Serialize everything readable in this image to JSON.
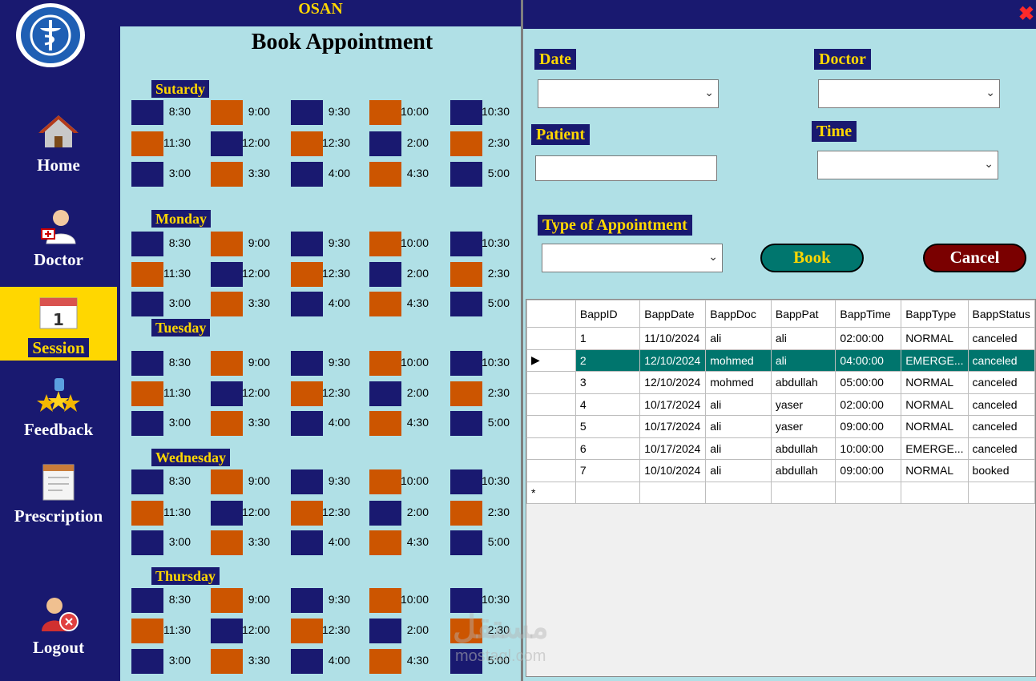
{
  "app": {
    "title": "OSAN",
    "page_title": "Book Appointment"
  },
  "sidebar": {
    "items": [
      {
        "label": "Home",
        "icon": "home-icon"
      },
      {
        "label": "Doctor",
        "icon": "doctor-icon"
      },
      {
        "label": "Session",
        "icon": "calendar-icon",
        "active": true
      },
      {
        "label": "Feedback",
        "icon": "feedback-stars-icon"
      },
      {
        "label": "Prescription",
        "icon": "prescription-icon"
      },
      {
        "label": "Logout",
        "icon": "logout-user-icon"
      }
    ]
  },
  "schedule": {
    "days": [
      "Sutardy",
      "Monday",
      "Tuesday",
      "Wednesday",
      "Thursday"
    ],
    "times": [
      [
        "8:30",
        "9:00",
        "9:30",
        "10:00",
        "10:30"
      ],
      [
        "11:30",
        "12:00",
        "12:30",
        "2:00",
        "2:30"
      ],
      [
        "3:00",
        "3:30",
        "4:00",
        "4:30",
        "5:00"
      ]
    ],
    "colors": {
      "blue": "#191970",
      "orange": "#cc5500"
    }
  },
  "form": {
    "date_label": "Date",
    "doctor_label": "Doctor",
    "patient_label": "Patient",
    "time_label": "Time",
    "type_label": "Type of Appointment",
    "book_label": "Book",
    "cancel_label": "Cancel",
    "close": "✖"
  },
  "grid": {
    "columns": [
      "BappID",
      "BappDate",
      "BappDoc",
      "BappPat",
      "BappTime",
      "BappType",
      "BappStatus"
    ],
    "rows": [
      [
        "1",
        "11/10/2024",
        "ali",
        "ali",
        "02:00:00",
        "NORMAL",
        "canceled"
      ],
      [
        "2",
        "12/10/2024",
        "mohmed",
        "ali",
        "04:00:00",
        "EMERGE...",
        "canceled"
      ],
      [
        "3",
        "12/10/2024",
        "mohmed",
        "abdullah",
        "05:00:00",
        "NORMAL",
        "canceled"
      ],
      [
        "4",
        "10/17/2024",
        "ali",
        "yaser",
        "02:00:00",
        "NORMAL",
        "canceled"
      ],
      [
        "5",
        "10/17/2024",
        "ali",
        "yaser",
        "09:00:00",
        "NORMAL",
        "canceled"
      ],
      [
        "6",
        "10/17/2024",
        "ali",
        "abdullah",
        "10:00:00",
        "EMERGE...",
        "canceled"
      ],
      [
        "7",
        "10/10/2024",
        "ali",
        "abdullah",
        "09:00:00",
        "NORMAL",
        "booked"
      ]
    ],
    "selected_row": 1,
    "current_marker": "▶",
    "new_row_marker": "*"
  },
  "watermark": {
    "arabic": "مستقل",
    "latin": "mostaql.com"
  }
}
